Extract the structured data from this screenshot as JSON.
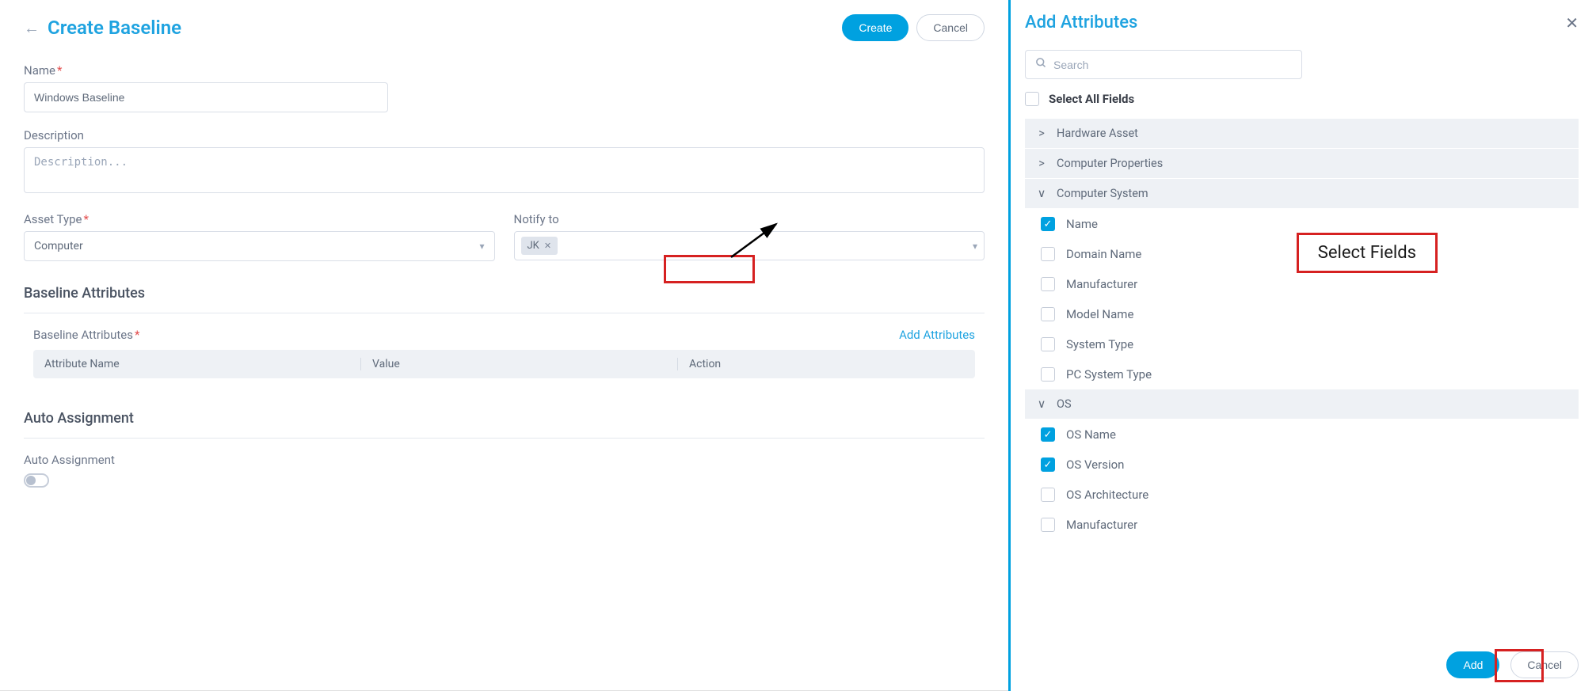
{
  "main": {
    "title": "Create Baseline",
    "create_label": "Create",
    "cancel_label": "Cancel",
    "name_label": "Name",
    "name_value": "Windows Baseline",
    "description_label": "Description",
    "description_placeholder": "Description...",
    "asset_type_label": "Asset Type",
    "asset_type_value": "Computer",
    "notify_to_label": "Notify to",
    "notify_to_tag": "JK",
    "baseline_attributes_title": "Baseline Attributes",
    "attributes_label": "Baseline Attributes",
    "add_attributes_link": "Add Attributes",
    "col_attribute_name": "Attribute Name",
    "col_value": "Value",
    "col_action": "Action",
    "auto_assignment_title": "Auto Assignment",
    "auto_assignment_label": "Auto Assignment"
  },
  "drawer": {
    "title": "Add Attributes",
    "search_placeholder": "Search",
    "select_all_label": "Select All Fields",
    "groups": [
      {
        "name": "Hardware Asset",
        "expanded": false,
        "fields": []
      },
      {
        "name": "Computer Properties",
        "expanded": false,
        "fields": []
      },
      {
        "name": "Computer System",
        "expanded": true,
        "fields": [
          {
            "name": "Name",
            "checked": true
          },
          {
            "name": "Domain Name",
            "checked": false
          },
          {
            "name": "Manufacturer",
            "checked": false
          },
          {
            "name": "Model Name",
            "checked": false
          },
          {
            "name": "System Type",
            "checked": false
          },
          {
            "name": "PC System Type",
            "checked": false
          }
        ]
      },
      {
        "name": "OS",
        "expanded": true,
        "fields": [
          {
            "name": "OS Name",
            "checked": true
          },
          {
            "name": "OS Version",
            "checked": true
          },
          {
            "name": "OS Architecture",
            "checked": false
          },
          {
            "name": "Manufacturer",
            "checked": false
          }
        ]
      }
    ],
    "add_label": "Add",
    "cancel_label": "Cancel"
  },
  "annotations": {
    "select_fields_text": "Select Fields"
  }
}
